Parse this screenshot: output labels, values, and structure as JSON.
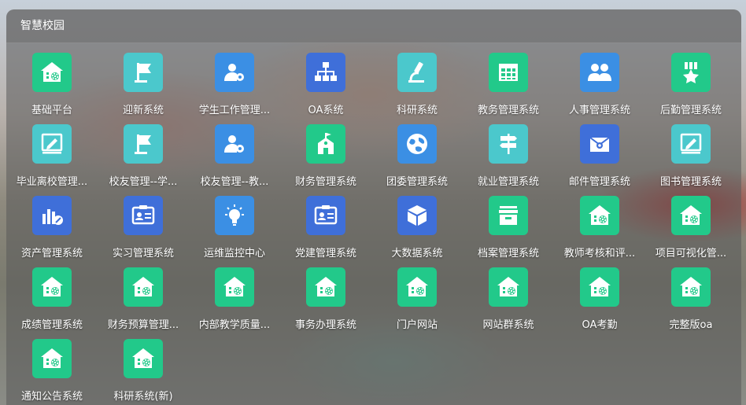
{
  "panel": {
    "title": "智慧校园"
  },
  "colors": {
    "green": "#22c98a",
    "teal": "#4bc8cc",
    "blue": "#3b8fe4",
    "navy": "#3f6fd9"
  },
  "apps": [
    {
      "label": "基础平台",
      "icon": "house-gear-icon",
      "color": "#22c98a"
    },
    {
      "label": "迎新系统",
      "icon": "flag-icon",
      "color": "#4bc8cc"
    },
    {
      "label": "学生工作管理...",
      "icon": "user-gear-icon",
      "color": "#3b8fe4"
    },
    {
      "label": "OA系统",
      "icon": "org-chart-icon",
      "color": "#3f6fd9"
    },
    {
      "label": "科研系统",
      "icon": "microscope-icon",
      "color": "#4bc8cc"
    },
    {
      "label": "教务管理系统",
      "icon": "table-grid-icon",
      "color": "#22c98a"
    },
    {
      "label": "人事管理系统",
      "icon": "people-icon",
      "color": "#3b8fe4"
    },
    {
      "label": "后勤管理系统",
      "icon": "medal-star-icon",
      "color": "#22c98a"
    },
    {
      "label": "毕业离校管理...",
      "icon": "pen-frame-icon",
      "color": "#4bc8cc"
    },
    {
      "label": "校友管理--学...",
      "icon": "flag-icon",
      "color": "#4bc8cc"
    },
    {
      "label": "校友管理--教...",
      "icon": "user-gear-icon",
      "color": "#3b8fe4"
    },
    {
      "label": "财务管理系统",
      "icon": "school-building-icon",
      "color": "#22c98a"
    },
    {
      "label": "团委管理系统",
      "icon": "globe-icon",
      "color": "#3b8fe4"
    },
    {
      "label": "就业管理系统",
      "icon": "signpost-icon",
      "color": "#4bc8cc"
    },
    {
      "label": "邮件管理系统",
      "icon": "mail-gear-icon",
      "color": "#3f6fd9"
    },
    {
      "label": "图书管理系统",
      "icon": "pen-frame-icon",
      "color": "#4bc8cc"
    },
    {
      "label": "资产管理系统",
      "icon": "bar-chart-icon",
      "color": "#3f6fd9"
    },
    {
      "label": "实习管理系统",
      "icon": "id-card-icon",
      "color": "#3f6fd9"
    },
    {
      "label": "运维监控中心",
      "icon": "lightbulb-icon",
      "color": "#3b8fe4"
    },
    {
      "label": "党建管理系统",
      "icon": "id-card-icon",
      "color": "#3f6fd9"
    },
    {
      "label": "大数据系统",
      "icon": "cube-icon",
      "color": "#3f6fd9"
    },
    {
      "label": "档案管理系统",
      "icon": "archive-box-icon",
      "color": "#22c98a"
    },
    {
      "label": "教师考核和评...",
      "icon": "house-gear-icon",
      "color": "#22c98a"
    },
    {
      "label": "项目可视化管...",
      "icon": "house-gear-icon",
      "color": "#22c98a"
    },
    {
      "label": "成绩管理系统",
      "icon": "house-gear-icon",
      "color": "#22c98a"
    },
    {
      "label": "财务预算管理...",
      "icon": "house-gear-icon",
      "color": "#22c98a"
    },
    {
      "label": "内部教学质量...",
      "icon": "house-gear-icon",
      "color": "#22c98a"
    },
    {
      "label": "事务办理系统",
      "icon": "house-gear-icon",
      "color": "#22c98a"
    },
    {
      "label": "门户网站",
      "icon": "house-gear-icon",
      "color": "#22c98a"
    },
    {
      "label": "网站群系统",
      "icon": "house-gear-icon",
      "color": "#22c98a"
    },
    {
      "label": "OA考勤",
      "icon": "house-gear-icon",
      "color": "#22c98a"
    },
    {
      "label": "完整版oa",
      "icon": "house-gear-icon",
      "color": "#22c98a"
    },
    {
      "label": "通知公告系统",
      "icon": "house-gear-icon",
      "color": "#22c98a"
    },
    {
      "label": "科研系统(新)",
      "icon": "house-gear-icon",
      "color": "#22c98a"
    }
  ]
}
